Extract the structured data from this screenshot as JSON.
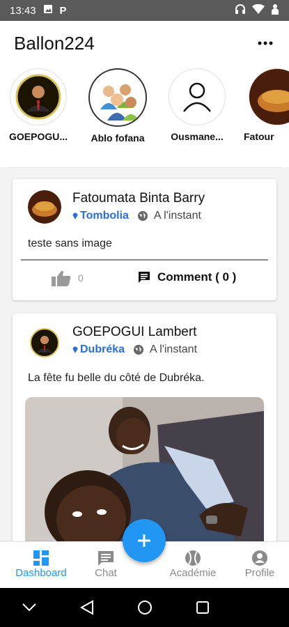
{
  "status_bar": {
    "time": "13:43",
    "p_label": "P"
  },
  "app_bar": {
    "title": "Ballon224"
  },
  "stories": [
    {
      "label": "GOEPOGU..."
    },
    {
      "label": "Ablo fofana"
    },
    {
      "label": "Ousmane..."
    },
    {
      "label": "Fatour"
    }
  ],
  "posts": [
    {
      "author": "Fatoumata Binta Barry",
      "location": "Tombolia",
      "time": "A l'instant",
      "text": "teste sans image",
      "likes": "0",
      "comment_label": "Comment ( 0 )"
    },
    {
      "author": "GOEPOGUI Lambert",
      "location": "Dubréka",
      "time": "A l'instant",
      "text": "La fête fu belle du côté de Dubréka."
    }
  ],
  "fab": {
    "label": "+"
  },
  "bottom_nav": [
    {
      "label": "Dashboard",
      "icon": "dashboard-icon",
      "active": true
    },
    {
      "label": "Chat",
      "icon": "chat-icon"
    },
    {
      "label": "Académie",
      "icon": "ball-icon"
    },
    {
      "label": "Profile",
      "icon": "person-icon"
    }
  ],
  "colors": {
    "accent": "#2196f3",
    "location": "#2b6fd6",
    "statusbar": "#5a5a5a"
  }
}
